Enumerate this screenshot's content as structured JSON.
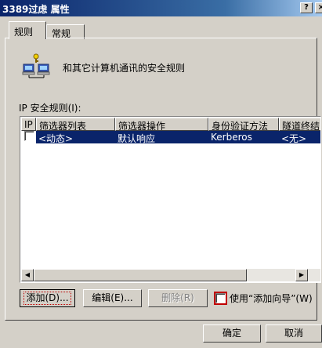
{
  "window": {
    "title": "3389过虑 属性",
    "help_label": "?",
    "close_label": "×"
  },
  "tabs": [
    {
      "label": "规则",
      "active": true
    },
    {
      "label": "常规",
      "active": false
    }
  ],
  "description": "和其它计算机通讯的安全规则",
  "rules_section_label": "IP 安全规则(I):",
  "table": {
    "headers": [
      "IP",
      "筛选器列表",
      "筛选器操作",
      "身份验证方法",
      "隧道终结"
    ],
    "rows": [
      {
        "checked": false,
        "filter_list": "<动态>",
        "filter_action": "默认响应",
        "auth_method": "Kerberos",
        "tunnel": "<无>"
      }
    ]
  },
  "scrollbar": {
    "left_arrow": "◀",
    "right_arrow": "▶"
  },
  "buttons": {
    "add": "添加(D)...",
    "edit": "编辑(E)...",
    "remove": "删除(R)",
    "ok": "确定",
    "cancel": "取消"
  },
  "wizard": {
    "label": "使用“添加向导”(W)",
    "checked": false
  },
  "colors": {
    "title_bar": "#0a246a",
    "selection": "#0a246a",
    "focus_highlight": "#c00000"
  },
  "icons": [
    "network-computers-icon",
    "help-icon",
    "close-icon",
    "scroll-left-icon",
    "scroll-right-icon"
  ]
}
